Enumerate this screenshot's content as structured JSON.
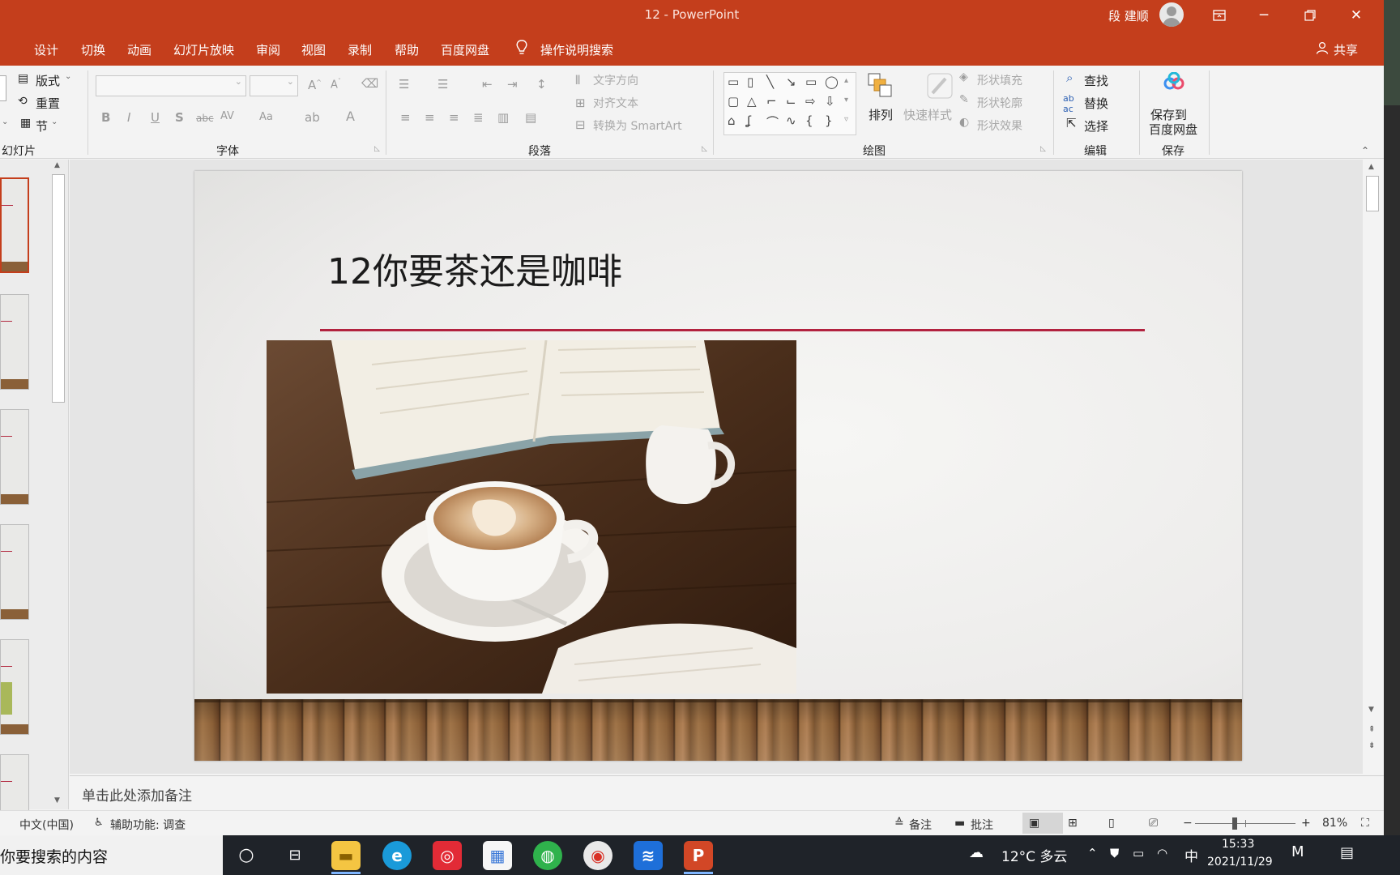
{
  "window": {
    "title": "12 - PowerPoint",
    "user": "段 建顺",
    "controls": [
      "ribbon-display-options",
      "minimize",
      "restore",
      "close"
    ]
  },
  "menu": {
    "items": [
      "设计",
      "切换",
      "动画",
      "幻灯片放映",
      "审阅",
      "视图",
      "录制",
      "帮助",
      "百度网盘"
    ],
    "tell_me": "操作说明搜索",
    "share": "共享"
  },
  "ribbon": {
    "slides_group": {
      "layout": "版式",
      "reset": "重置",
      "section": "节",
      "label": "幻灯片"
    },
    "font_group": {
      "label": "字体",
      "buttons": [
        "B",
        "I",
        "U",
        "S",
        "abc",
        "AV",
        "Aa",
        "A"
      ]
    },
    "paragraph_group": {
      "text_direction": "文字方向",
      "align_text": "对齐文本",
      "smartart": "转换为 SmartArt",
      "label": "段落"
    },
    "drawing_group": {
      "arrange": "排列",
      "quick_styles": "快速样式",
      "shape_fill": "形状填充",
      "shape_outline": "形状轮廓",
      "shape_effects": "形状效果",
      "label": "绘图"
    },
    "editing_group": {
      "find": "查找",
      "replace": "替换",
      "select": "选择",
      "label": "编辑"
    },
    "save_group": {
      "save_to_line1": "保存到",
      "save_to_line2": "百度网盘",
      "label": "保存"
    }
  },
  "slide": {
    "title": "12你要茶还是咖啡",
    "accent_color": "#b2223f"
  },
  "notes": {
    "placeholder": "单击此处添加备注"
  },
  "status": {
    "language": "中文(中国)",
    "accessibility": "辅助功能: 调查",
    "notes": "备注",
    "comments": "批注",
    "zoom_minus": "−",
    "zoom_plus": "+",
    "zoom": "81%",
    "zoom_level": 0.81
  },
  "taskbar": {
    "search_placeholder": "你要搜索的内容",
    "weather": "12°C 多云",
    "ime": "中",
    "time": "15:33",
    "date": "2021/11/29"
  },
  "colors": {
    "brand": "#c43e1c",
    "taskbar": "#1f2329"
  }
}
